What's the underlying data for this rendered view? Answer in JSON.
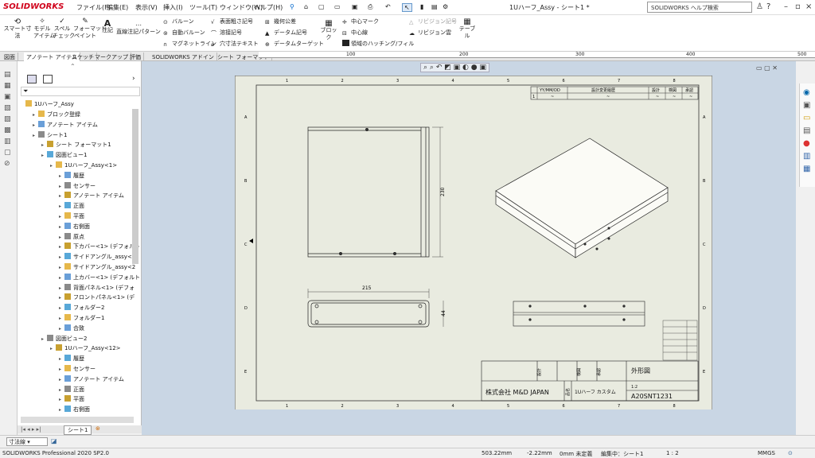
{
  "app": {
    "brand": "SOLIDWORKS",
    "doc_title": "1Uハーフ_Assy - シート1 *",
    "help_search": "SOLIDWORKS ヘルプ検索"
  },
  "menus": [
    "ファイル(F)",
    "編集(E)",
    "表示(V)",
    "挿入(I)",
    "ツール(T)",
    "ウィンドウ(W)",
    "ヘルプ(H)"
  ],
  "ribbon": {
    "smart_dim": "スマート寸法",
    "model_item": "モデル\nアイテム",
    "spell": "スペル\nチェック",
    "format_paint": "フォーマット\nペイント",
    "note": "注記",
    "linear_note": "直線注記パターン",
    "balloon": "バルーン",
    "auto_balloon": "自動バルーン",
    "magnetic_line": "マグネットライン",
    "surface_finish": "表面粗さ記号",
    "weld_symbol": "溶接記号",
    "hole_callout": "穴寸法テキスト",
    "geom_tol": "幾何公差",
    "datum_feature": "データム記号",
    "datum_target": "データムターゲット",
    "block": "ブロック",
    "center_mark": "中心マーク",
    "centerline": "中心線",
    "hatch": "領域のハッチング/フィル",
    "rev_symbol": "リビジョン記号",
    "rev_cloud": "リビジョン雲",
    "table": "テーブル"
  },
  "command_tabs": [
    "図面",
    "アノテート アイテム",
    "スケッチ",
    "マークアップ",
    "評価",
    "SOLIDWORKS アドイン",
    "シート フォーマット"
  ],
  "ruler_ticks": [
    "100",
    "200",
    "300",
    "400",
    "500"
  ],
  "tree": {
    "root": "1Uハーフ_Assy",
    "nodes": [
      {
        "label": "ブロック登録",
        "depth": 1
      },
      {
        "label": "アノテート アイテム",
        "depth": 1
      },
      {
        "label": "シート1",
        "depth": 1
      },
      {
        "label": "シート フォーマット1",
        "depth": 2
      },
      {
        "label": "図面ビュー1",
        "depth": 2
      },
      {
        "label": "1Uハーフ_Assy<1>",
        "depth": 3
      },
      {
        "label": "履歴",
        "depth": 4
      },
      {
        "label": "センサー",
        "depth": 4
      },
      {
        "label": "アノテート アイテム",
        "depth": 4
      },
      {
        "label": "正面",
        "depth": 4
      },
      {
        "label": "平面",
        "depth": 4
      },
      {
        "label": "右側面",
        "depth": 4
      },
      {
        "label": "原点",
        "depth": 4
      },
      {
        "label": "下カバー<1> (デフォルト",
        "depth": 4
      },
      {
        "label": "サイドアングル_assy<1",
        "depth": 4
      },
      {
        "label": "サイドアングル_assy<2",
        "depth": 4
      },
      {
        "label": "上カバー<1> (デフォルト",
        "depth": 4
      },
      {
        "label": "背面パネル<1> (デフォ",
        "depth": 4
      },
      {
        "label": "フロントパネル<1> (デ",
        "depth": 4
      },
      {
        "label": "フォルダー2",
        "depth": 4
      },
      {
        "label": "フォルダー1",
        "depth": 4
      },
      {
        "label": "合致",
        "depth": 4
      },
      {
        "label": "図面ビュー2",
        "depth": 2
      },
      {
        "label": "1Uハーフ_Assy<12>",
        "depth": 3
      },
      {
        "label": "履歴",
        "depth": 4
      },
      {
        "label": "センサー",
        "depth": 4
      },
      {
        "label": "アノテート アイテム",
        "depth": 4
      },
      {
        "label": "正面",
        "depth": 4
      },
      {
        "label": "平面",
        "depth": 4
      },
      {
        "label": "右側面",
        "depth": 4
      }
    ]
  },
  "sheet_tab": "シート1",
  "drawing": {
    "rev_headers": [
      "YY/MM/DD",
      "設計変更履歴",
      "設計",
      "検図",
      "承認"
    ],
    "rev_row": [
      "1",
      "~"
    ],
    "dim_width": "215",
    "dim_height": "230",
    "dim_depth": "44",
    "col_labels": [
      "1",
      "2",
      "3",
      "4",
      "5",
      "6",
      "7",
      "8"
    ],
    "row_labels": [
      "A",
      "B",
      "C",
      "D",
      "E"
    ],
    "title_block": {
      "design": "設計",
      "check": "検図",
      "approve": "承認",
      "company": "株式会社 M&D JAPAN",
      "product_label": "品名",
      "product": "1Uハーフ カスタム",
      "drawing_name": "外形図",
      "drawing_no": "A20SNT1231",
      "scale": "1:2"
    }
  },
  "dim_selector": "寸法線",
  "status": {
    "product": "SOLIDWORKS Professional 2020 SP2.0",
    "x": "503.22mm",
    "y": "-2.22mm",
    "z": "0mm 未定義",
    "edit": "編集中：シート1",
    "scale": "1 : 2",
    "units": "MMGS"
  }
}
